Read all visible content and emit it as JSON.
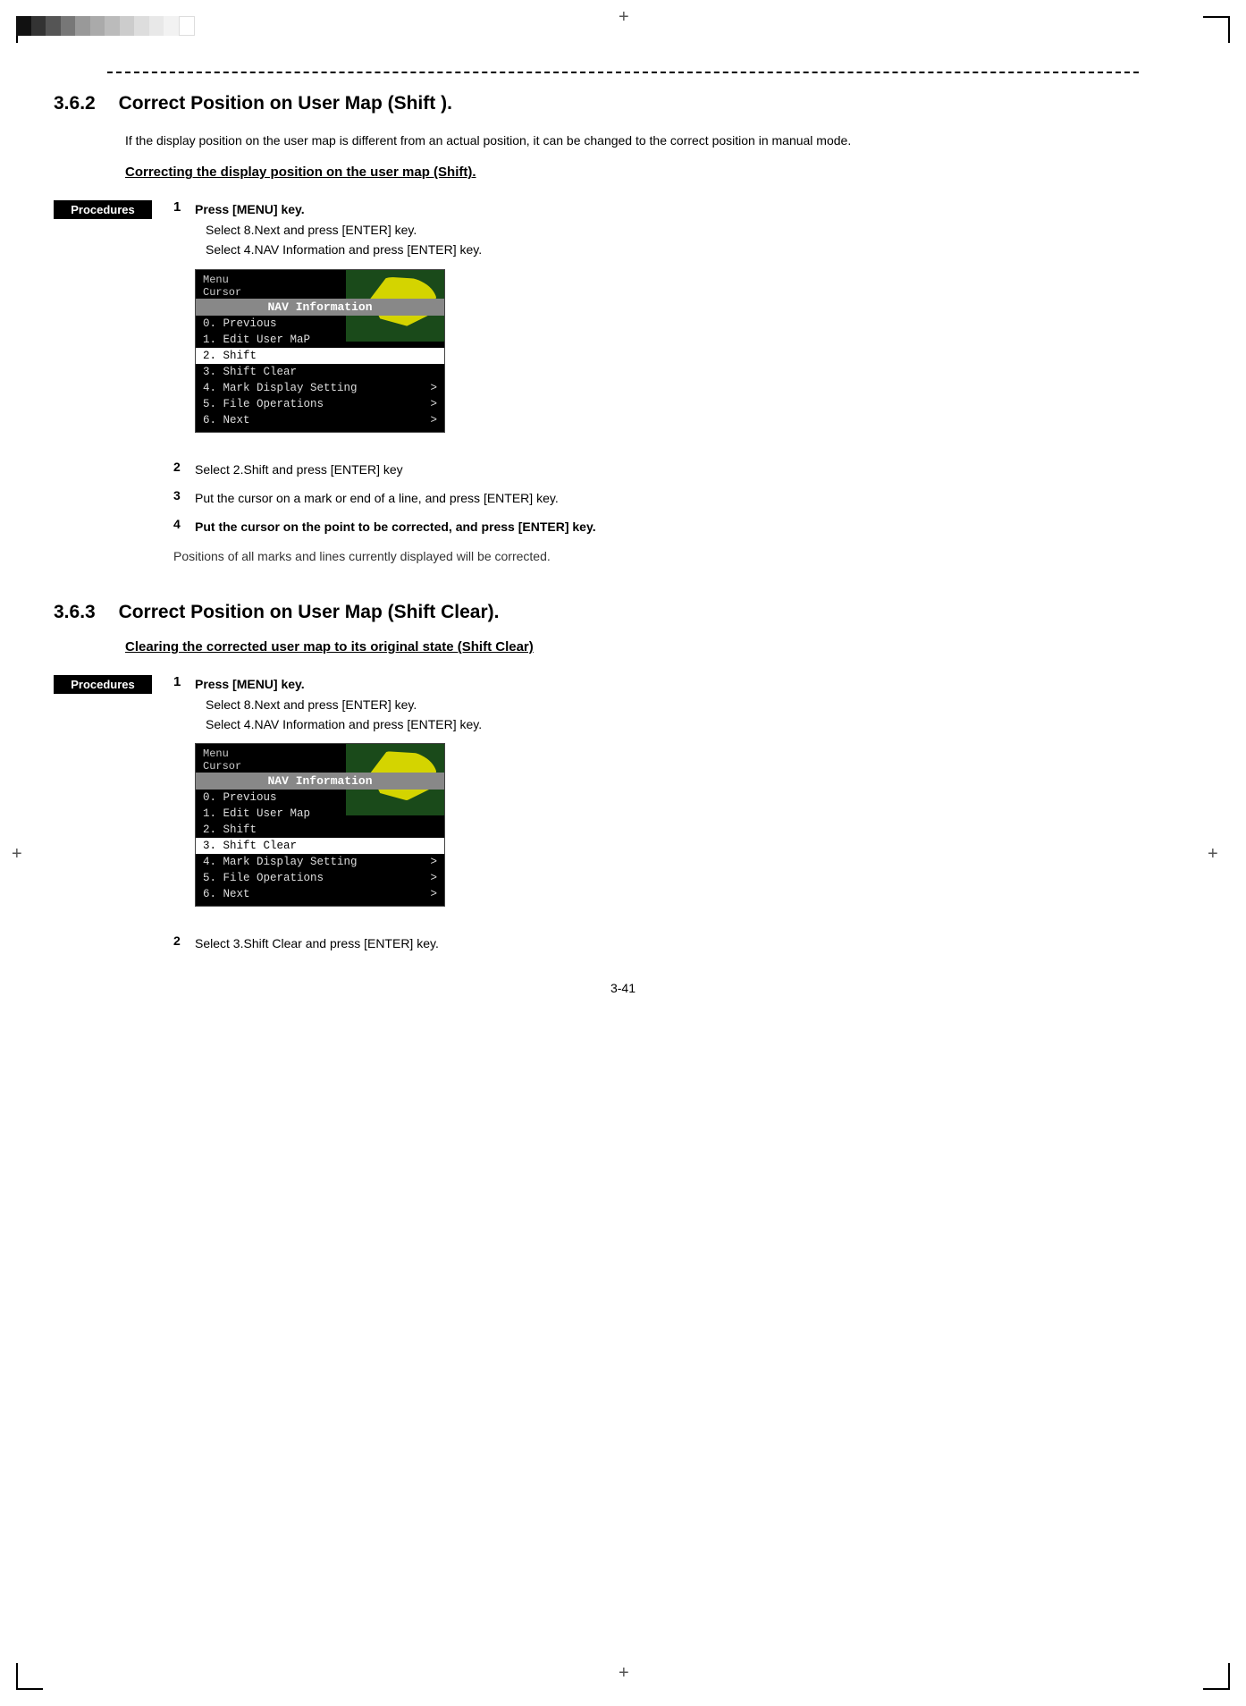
{
  "grayscale": {
    "colors": [
      "#111",
      "#333",
      "#555",
      "#777",
      "#999",
      "#aaa",
      "#bbb",
      "#ccc",
      "#ddd",
      "#eee",
      "#f5f5f5",
      "#fff"
    ]
  },
  "section1": {
    "number": "3.6.2",
    "title": "Correct Position on User Map (Shift ).",
    "body": "If the display position on the user map is different from an actual position, it can be changed to the correct position in manual mode.",
    "subheading": "Correcting the display position on the user map (Shift).",
    "procedures_label": "Procedures",
    "step1_num": "1",
    "step1_line1": "Press [MENU] key.",
    "step1_line2": "Select   8.Next   and press [ENTER] key.",
    "step1_line3": "Select   4.NAV Information and press [ENTER] key.",
    "step2_num": "2",
    "step2_text": "Select   2.Shift and press [ENTER] key",
    "step3_num": "3",
    "step3_text": "Put the cursor on a mark or end of a line, and press [ENTER] key.",
    "step4_num": "4",
    "step4_text": "Put the cursor on the point to be corrected, and press [ENTER] key.",
    "positions_note": "Positions of all marks and lines currently displayed will be corrected.",
    "menu1": {
      "line1": "Menu",
      "line2": "Cursor",
      "title": "NAV Information",
      "items": [
        {
          "text": "0. Previous",
          "highlight": false,
          "arrow": false
        },
        {
          "text": "1. Edit User Map",
          "highlight": false,
          "arrow": true
        },
        {
          "text": "2. Shift",
          "highlight": true,
          "arrow": false
        },
        {
          "text": "3. Shift Clear",
          "highlight": false,
          "arrow": false
        },
        {
          "text": "4. Mark Display Setting",
          "highlight": false,
          "arrow": true
        },
        {
          "text": "5. File Operations",
          "highlight": false,
          "arrow": true
        },
        {
          "text": "6. Next",
          "highlight": false,
          "arrow": true
        }
      ]
    }
  },
  "section2": {
    "number": "3.6.3",
    "title": "Correct Position on User Map (Shift Clear).",
    "subheading": "Clearing the corrected user map to its original state (Shift Clear)",
    "procedures_label": "Procedures",
    "step1_num": "1",
    "step1_line1": "Press [MENU] key.",
    "step1_line2": "Select   8.Next   and press [ENTER] key.",
    "step1_line3": "Select   4.NAV Information and press [ENTER] key.",
    "step2_num": "2",
    "step2_text": "Select   3.Shift Clear and press [ENTER] key.",
    "menu2": {
      "line1": "Menu",
      "line2": "Cursor",
      "title": "NAV Information",
      "items": [
        {
          "text": "0. Previous",
          "highlight": false,
          "arrow": false
        },
        {
          "text": "1. Edit User Map",
          "highlight": false,
          "arrow": true
        },
        {
          "text": "2. Shift",
          "highlight": false,
          "arrow": false
        },
        {
          "text": "3. Shift Clear",
          "highlight": true,
          "arrow": false
        },
        {
          "text": "4. Mark Display Setting",
          "highlight": false,
          "arrow": true
        },
        {
          "text": "5. File Operations",
          "highlight": false,
          "arrow": true
        },
        {
          "text": "6. Next",
          "highlight": false,
          "arrow": true
        }
      ]
    }
  },
  "page_number": "3-41"
}
